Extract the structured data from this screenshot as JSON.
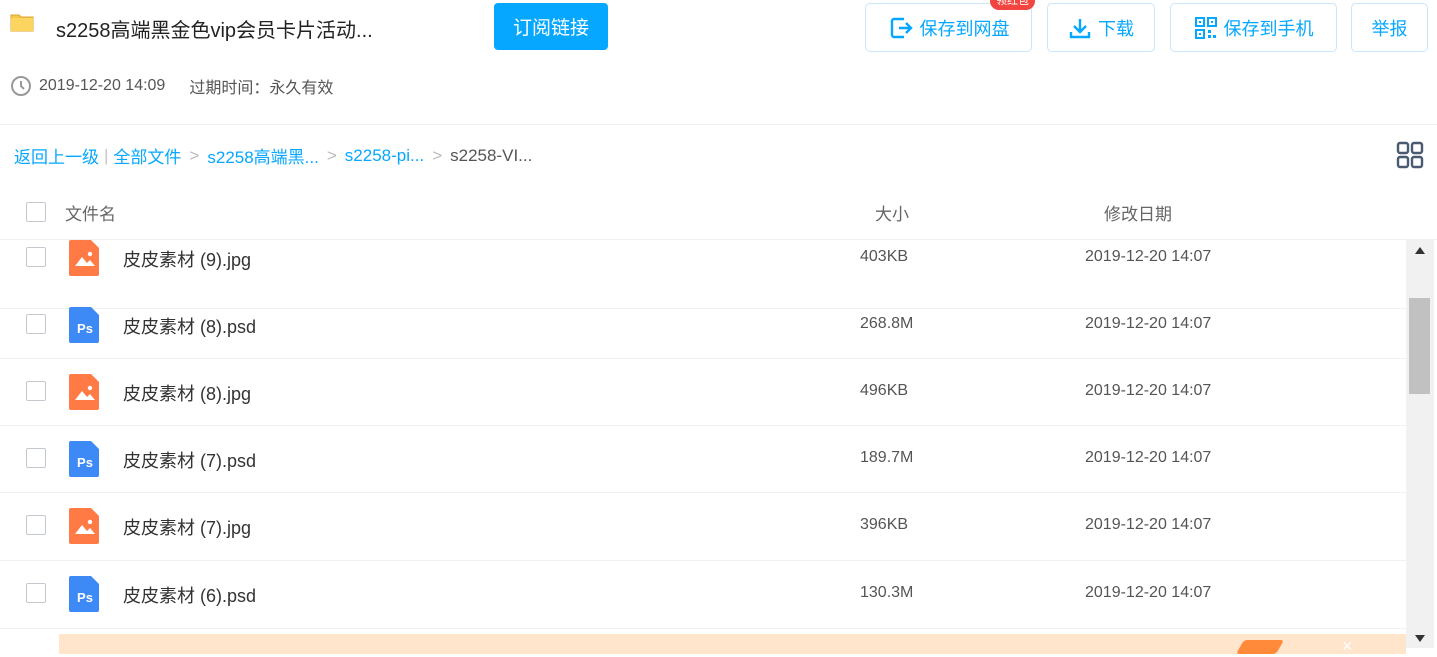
{
  "header": {
    "title": "s2258高端黑金色vip会员卡片活动...",
    "subscribe_label": "订阅链接",
    "actions": {
      "save_to_disk": "保存到网盘",
      "save_badge": "领红包",
      "download": "下载",
      "save_to_phone": "保存到手机",
      "report": "举报"
    }
  },
  "meta": {
    "datetime": "2019-12-20 14:09",
    "expire": "过期时间：永久有效"
  },
  "breadcrumb": {
    "back": "返回上一级",
    "separator_bar": "|",
    "items": [
      "全部文件",
      "s2258高端黑...",
      "s2258-pi..."
    ],
    "arrow": ">",
    "current": "s2258-VI..."
  },
  "table": {
    "columns": {
      "name": "文件名",
      "size": "大小",
      "date": "修改日期"
    },
    "rows": [
      {
        "name": "皮皮素材 (9).jpg",
        "size": "403KB",
        "date": "2019-12-20 14:07",
        "type": "image"
      },
      {
        "name": "皮皮素材 (8).psd",
        "size": "268.8M",
        "date": "2019-12-20 14:07",
        "type": "ps"
      },
      {
        "name": "皮皮素材 (8).jpg",
        "size": "496KB",
        "date": "2019-12-20 14:07",
        "type": "image"
      },
      {
        "name": "皮皮素材 (7).psd",
        "size": "189.7M",
        "date": "2019-12-20 14:07",
        "type": "ps"
      },
      {
        "name": "皮皮素材 (7).jpg",
        "size": "396KB",
        "date": "2019-12-20 14:07",
        "type": "image"
      },
      {
        "name": "皮皮素材 (6).psd",
        "size": "130.3M",
        "date": "2019-12-20 14:07",
        "type": "ps"
      }
    ]
  },
  "icons": {
    "ps_text": "Ps",
    "banner_close": "×"
  },
  "colors": {
    "accent": "#06a7ff",
    "image_icon": "#ff7a45",
    "ps_icon": "#3d8af7",
    "badge": "#f2453f"
  }
}
